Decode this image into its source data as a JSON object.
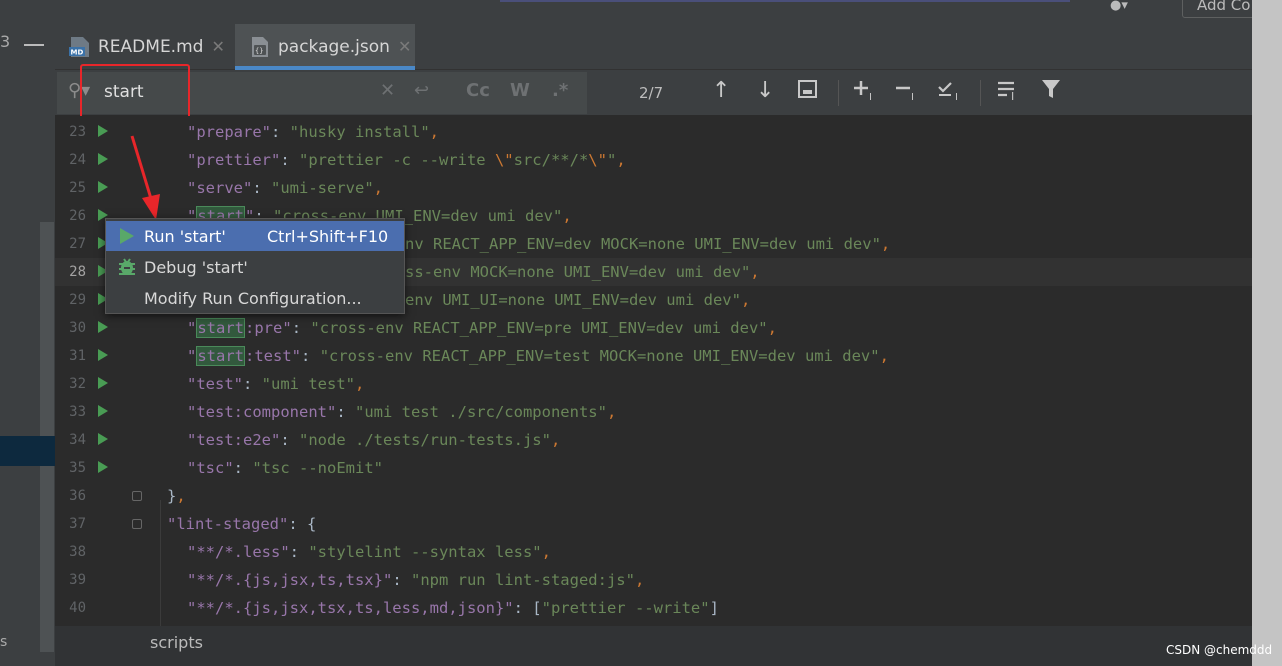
{
  "top": {
    "add_config_label": "Add Co"
  },
  "left": {
    "partial_number": "3",
    "partial_letter": "s"
  },
  "tabs": [
    {
      "label": "README.md",
      "icon": "markdown-file-icon"
    },
    {
      "label": "package.json",
      "icon": "json-file-icon",
      "active": true
    }
  ],
  "search": {
    "value": "start",
    "match_count": "2/7",
    "toggles": [
      "Cc",
      "W",
      ".*"
    ]
  },
  "popup": {
    "items": [
      {
        "label": "Run 'start'",
        "shortcut": "Ctrl+Shift+F10",
        "icon": "run-icon"
      },
      {
        "label": "Debug 'start'",
        "shortcut": "",
        "icon": "debug-icon"
      },
      {
        "label": "Modify Run Configuration...",
        "shortcut": "",
        "icon": ""
      }
    ]
  },
  "editor": {
    "line_numbers": [
      "23",
      "24",
      "25",
      "26",
      "27",
      "28",
      "29",
      "30",
      "31",
      "32",
      "33",
      "34",
      "35",
      "36",
      "37",
      "38",
      "39",
      "40"
    ],
    "current_line": "28"
  },
  "breadcrumb": "scripts",
  "watermark": "CSDN @chemddd",
  "colors": {
    "accent": "#4a88c7",
    "selection": "#4b6eaf",
    "run_green": "#499c54",
    "highlight_border": "#e8262a"
  }
}
